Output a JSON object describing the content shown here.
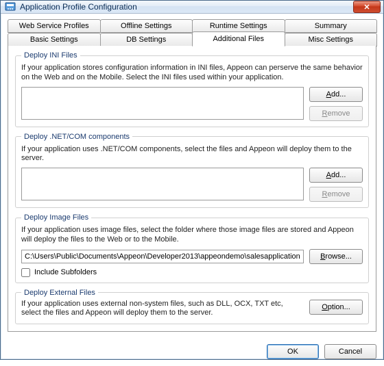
{
  "window": {
    "title": "Application Profile Configuration",
    "close_glyph": "✕"
  },
  "tabs": {
    "row1": [
      "Web Service Profiles",
      "Offline Settings",
      "Runtime Settings",
      "Summary"
    ],
    "row2": [
      "Basic Settings",
      "DB Settings",
      "Additional Files",
      "Misc Settings"
    ],
    "active": "Additional Files"
  },
  "groups": {
    "ini": {
      "legend": "Deploy INI Files",
      "desc": "If your application stores configuration information in INI files, Appeon can perserve the same behavior on the Web and on the Mobile. Select the INI files used within your application.",
      "add_label": "Add...",
      "remove_label": "Remove"
    },
    "netcom": {
      "legend": "Deploy .NET/COM components",
      "desc": "If your application uses .NET/COM components, select the files and Appeon will deploy them to the server.",
      "add_label": "Add...",
      "remove_label": "Remove"
    },
    "image": {
      "legend": "Deploy Image Files",
      "desc": "If your application uses image files, select the folder where those image files are stored and Appeon will deploy the files to the Web or to the Mobile.",
      "path": "C:\\Users\\Public\\Documents\\Appeon\\Developer2013\\appeondemo\\salesapplication",
      "browse_label": "Browse...",
      "include_label": "Include Subfolders",
      "include_checked": false
    },
    "external": {
      "legend": "Deploy External Files",
      "desc": "If your application uses external non-system files, such as DLL, OCX, TXT etc, select the files and Appeon will deploy them to the server.",
      "option_label": "Option..."
    }
  },
  "footer": {
    "ok": "OK",
    "cancel": "Cancel"
  }
}
